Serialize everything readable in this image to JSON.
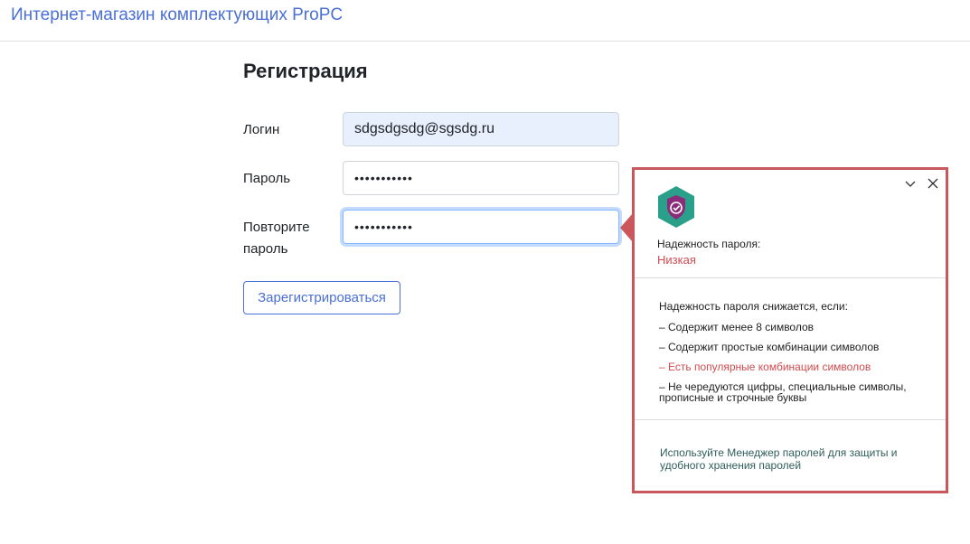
{
  "navbar": {
    "brand": "Интернет-магазин комплектующих ProPC"
  },
  "form": {
    "title": "Регистрация",
    "login_label": "Логин",
    "login_value": "sdgsdgsdg@sgsdg.ru",
    "password_label": "Пароль",
    "password_value": "•••••••••••",
    "repeat_label_line1": "Повторите",
    "repeat_label_line2": "пароль",
    "repeat_value": "•••••••••••",
    "submit_label": "Зарегистрироваться"
  },
  "password_popup": {
    "strength_label": "Надежность пароля:",
    "strength_value": "Низкая",
    "reasons_title": "Надежность пароля снижается, если:",
    "reasons": [
      {
        "text": "–  Содержит менее 8 символов"
      },
      {
        "text": "–  Содержит простые комбинации символов"
      },
      {
        "text": "–  Есть популярные комбинации символов"
      },
      {
        "text": "–  Не чередуются цифры, специальные символы, прописные и строчные буквы"
      }
    ],
    "tip": "Используйте Менеджер паролей для защиты и удобного хранения паролей",
    "icons": {
      "shield": "shield-check-icon",
      "collapse": "chevron-down-icon",
      "close": "close-icon"
    }
  },
  "colors": {
    "brand_link": "#4a6fd6",
    "popup_border": "#c9575c",
    "weak_strength": "#d24b4f",
    "shield": "#2aa08a",
    "shield_inner": "#8b2c7a",
    "tip_text": "#2f5e5a",
    "autofill_bg": "#e8f0fe"
  }
}
